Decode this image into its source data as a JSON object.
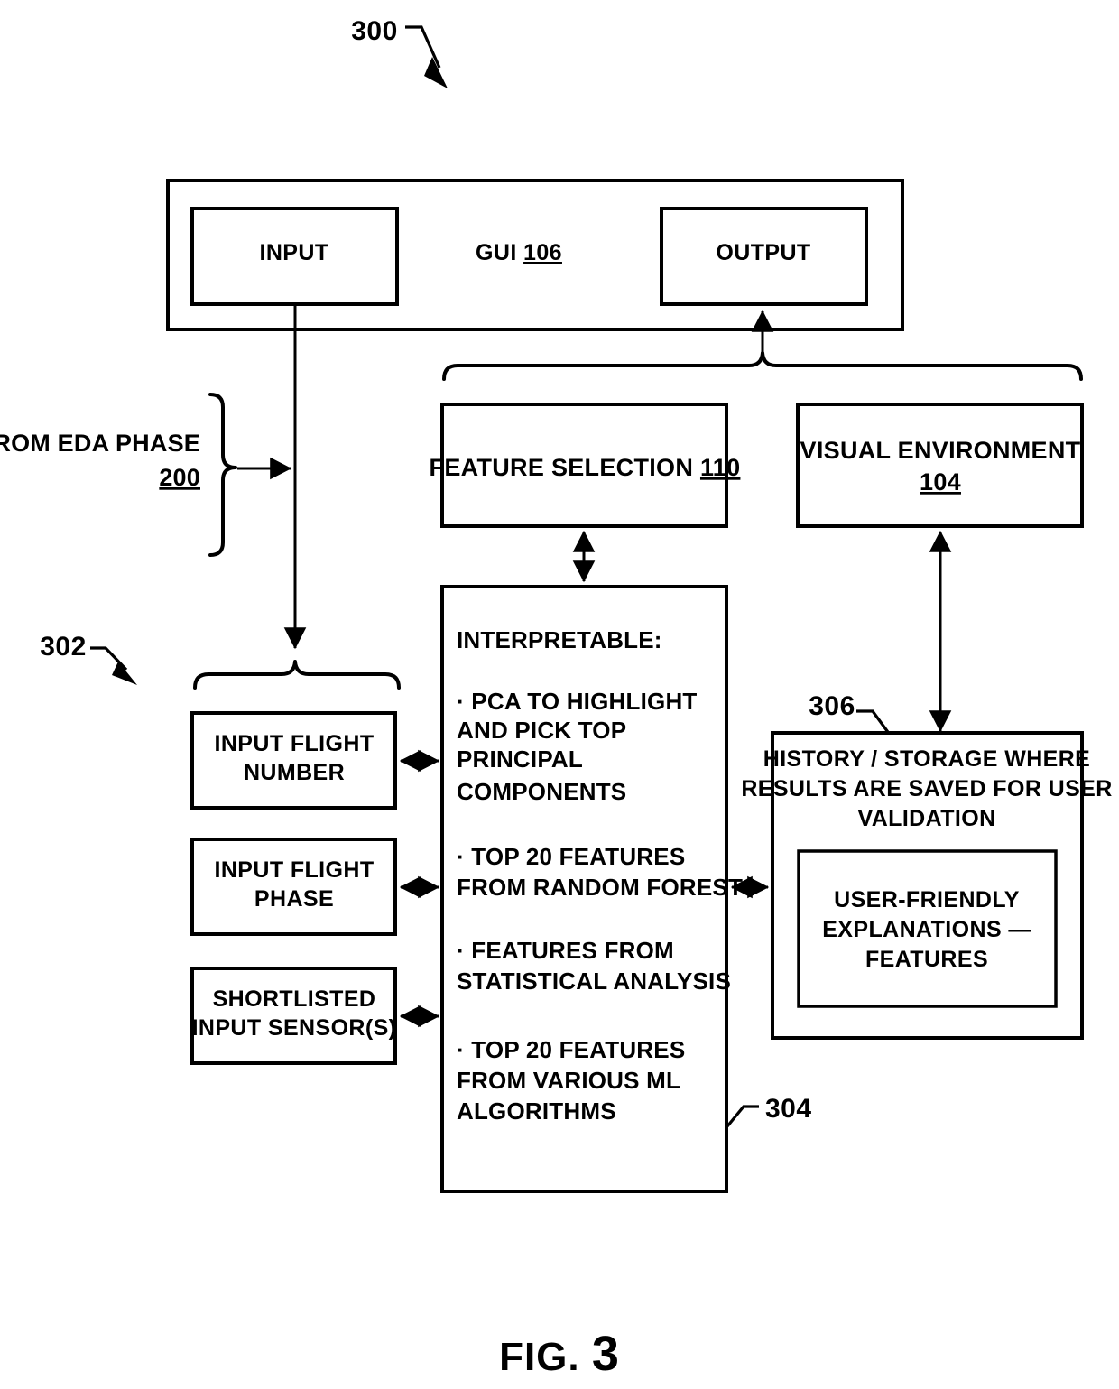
{
  "figure": {
    "label": "FIG.",
    "number": "3",
    "diagram_ref": "300"
  },
  "refs": {
    "main": "300",
    "input_group": "302",
    "interpretable_box": "304",
    "history_box": "306"
  },
  "gui_panel": {
    "title": "GUI",
    "title_ref": "106",
    "input_box": "INPUT",
    "output_box": "OUTPUT"
  },
  "eda": {
    "line1": "FROM EDA PHASE",
    "line2": "200"
  },
  "feature_selection": {
    "label": "FEATURE SELECTION",
    "ref": "110"
  },
  "visual_environment": {
    "line1": "VISUAL ENVIRONMENT",
    "ref": "104"
  },
  "inputs": [
    {
      "line1": "INPUT FLIGHT",
      "line2": "NUMBER"
    },
    {
      "line1": "INPUT FLIGHT",
      "line2": "PHASE"
    },
    {
      "line1": "SHORTLISTED",
      "line2": "INPUT SENSOR(S)"
    }
  ],
  "interpretable": {
    "heading": "INTERPRETABLE:",
    "bullet_char": "·",
    "bullets": [
      [
        "PCA TO HIGHLIGHT",
        "AND PICK TOP",
        "PRINCIPAL",
        "COMPONENTS"
      ],
      [
        "TOP 20 FEATURES",
        "FROM RANDOM FOREST"
      ],
      [
        "FEATURES FROM",
        "STATISTICAL ANALYSIS"
      ],
      [
        "TOP 20 FEATURES",
        "FROM VARIOUS ML",
        "ALGORITHMS"
      ]
    ]
  },
  "history": {
    "line1": "HISTORY / STORAGE WHERE",
    "line2": "RESULTS ARE SAVED FOR USER",
    "line3": "VALIDATION",
    "inner": {
      "line1": "USER-FRIENDLY",
      "line2": "EXPLANATIONS —",
      "line3": "FEATURES"
    }
  },
  "colors": {
    "stroke": "#000000",
    "fill": "#ffffff"
  }
}
